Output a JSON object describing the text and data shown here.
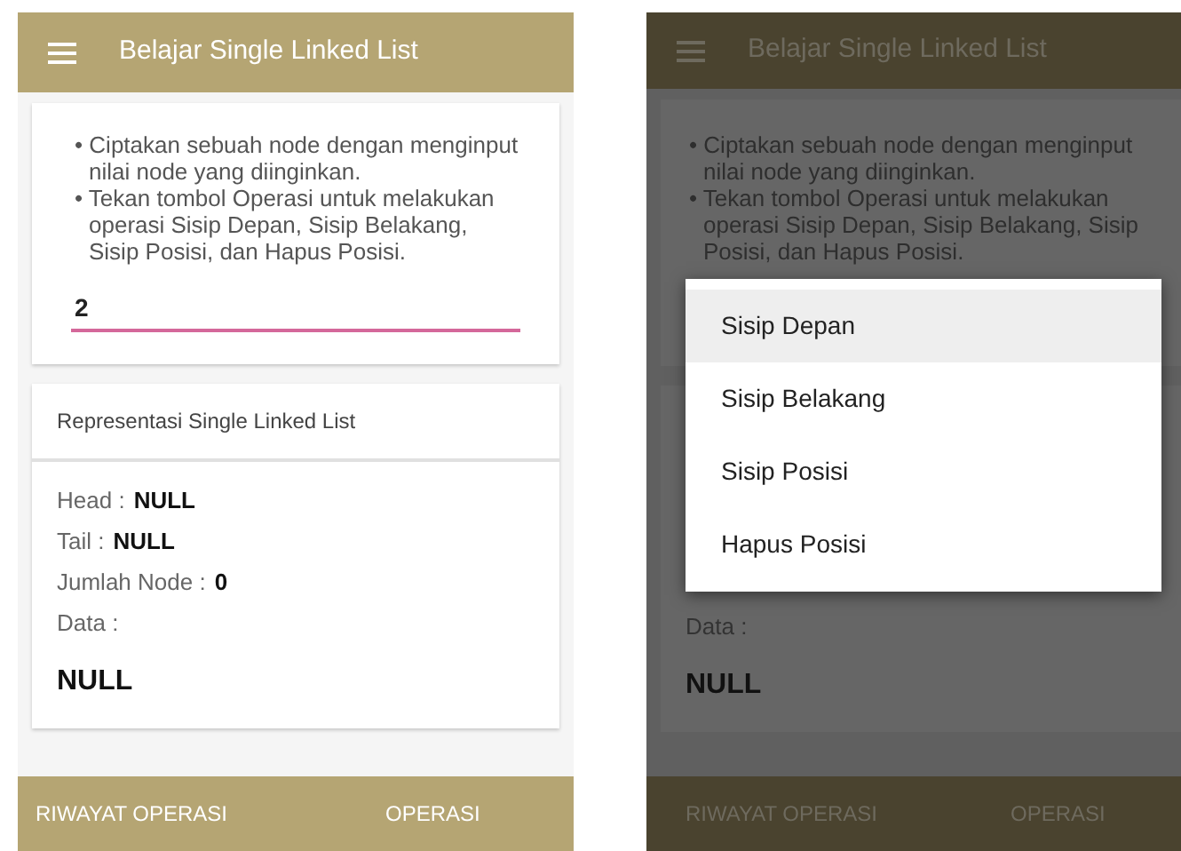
{
  "left_screen": {
    "app_bar": {
      "title": "Belajar Single Linked List"
    },
    "instructions": [
      "•  Ciptakan sebuah node dengan menginput nilai node yang diinginkan.",
      "• Tekan tombol Operasi untuk melakukan operasi Sisip Depan, Sisip Belakang, Sisip Posisi, dan Hapus Posisi."
    ],
    "node_input": {
      "value": "2"
    },
    "representation": {
      "title": "Representasi Single Linked List",
      "fields": [
        {
          "label": "Head :",
          "value": "NULL"
        },
        {
          "label": "Tail :",
          "value": "NULL"
        },
        {
          "label": "Jumlah Node :",
          "value": "0"
        },
        {
          "label": "Data :"
        }
      ],
      "data_value": "NULL"
    },
    "bottom_bar": [
      "RIWAYAT OPERASI",
      "OPERASI"
    ]
  },
  "right_screen": {
    "app_bar": {
      "title": "Belajar Single Linked List"
    },
    "instructions": [
      "•  Ciptakan sebuah node dengan menginput nilai node yang diinginkan.",
      "• Tekan tombol Operasi untuk melakukan operasi Sisip Depan, Sisip Belakang, Sisip Posisi, dan Hapus Posisi."
    ],
    "menu": [
      {
        "label": "Sisip Depan",
        "selected": true
      },
      {
        "label": "Sisip Belakang",
        "selected": false
      },
      {
        "label": "Sisip Posisi",
        "selected": false
      },
      {
        "label": "Hapus Posisi",
        "selected": false
      }
    ],
    "data_label": "Data :",
    "data_value": "NULL",
    "bottom_bar": [
      "RIWAYAT OPERASI",
      "OPERASI"
    ]
  }
}
